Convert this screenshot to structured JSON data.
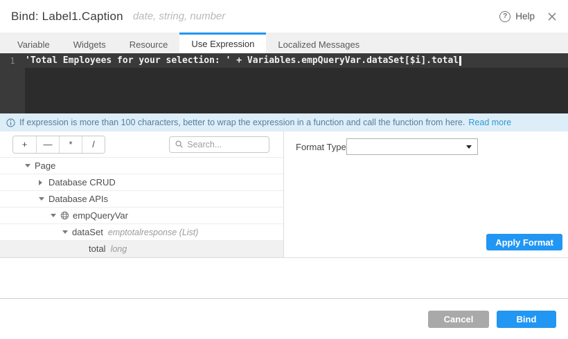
{
  "header": {
    "title": "Bind: Label1.Caption",
    "subtitle": "date, string, number",
    "help_icon_glyph": "?",
    "help_label": "Help"
  },
  "tabs": [
    {
      "label": "Variable",
      "active": false
    },
    {
      "label": "Widgets",
      "active": false
    },
    {
      "label": "Resource",
      "active": false
    },
    {
      "label": "Use Expression",
      "active": true
    },
    {
      "label": "Localized Messages",
      "active": false
    }
  ],
  "editor": {
    "line_number": "1",
    "code": "'Total Employees for your selection: ' + Variables.empQueryVar.dataSet[$i].total"
  },
  "info_bar": {
    "message": "If expression is more than 100 characters, better to wrap the expression in a function and call the function from here.",
    "link_label": "Read more"
  },
  "toolbar": {
    "operators": [
      "+",
      "—",
      "*",
      "/"
    ],
    "search_placeholder": "Search..."
  },
  "tree": {
    "rows": [
      {
        "label": "Page",
        "meta": "",
        "state": "expanded"
      },
      {
        "label": "Database CRUD",
        "meta": "",
        "state": "collapsed"
      },
      {
        "label": "Database APIs",
        "meta": "",
        "state": "expanded"
      },
      {
        "label": "empQueryVar",
        "meta": "",
        "state": "expanded",
        "icon": "service-variable-icon"
      },
      {
        "label": "dataSet",
        "meta": "emptotalresponse (List)",
        "state": "expanded"
      },
      {
        "label": "total",
        "meta": "long",
        "state": "leaf",
        "selected": true
      }
    ]
  },
  "format_panel": {
    "label": "Format Type",
    "selected_value": "",
    "apply_button_label": "Apply Format"
  },
  "footer": {
    "cancel_label": "Cancel",
    "bind_label": "Bind"
  },
  "colors": {
    "accent": "#2196f3",
    "cancel_gray": "#a9a9a9",
    "editor_bg": "#2c2c2c",
    "info_bg": "#ddeef9",
    "info_text": "#557e9b",
    "link_blue": "#2d9ad3"
  }
}
